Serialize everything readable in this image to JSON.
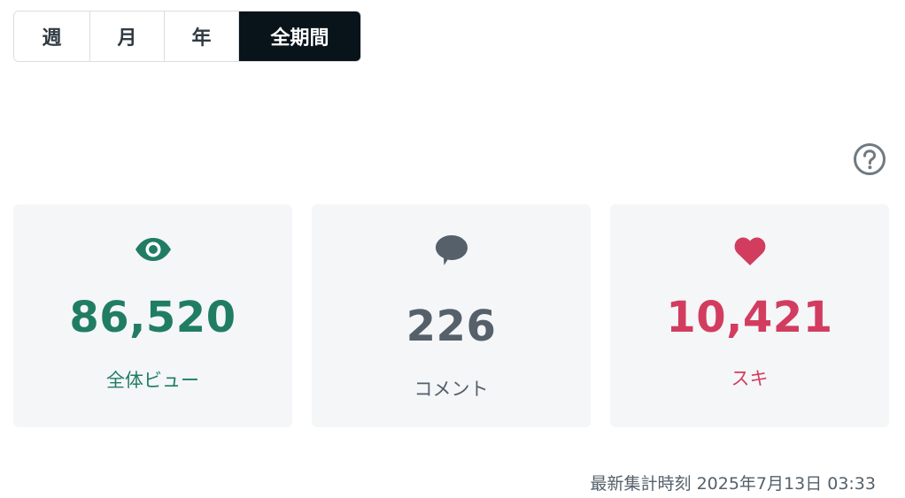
{
  "period_tabs": {
    "items": [
      {
        "label": "週"
      },
      {
        "label": "月"
      },
      {
        "label": "年"
      },
      {
        "label": "全期間"
      }
    ],
    "active": "全期間"
  },
  "help": {
    "icon": "question-circle-icon"
  },
  "stats": {
    "views": {
      "value": "86,520",
      "label": "全体ビュー",
      "icon": "eye-icon",
      "color": "#207d64"
    },
    "comments": {
      "value": "226",
      "label": "コメント",
      "icon": "speech-bubble-icon",
      "color": "#55606a"
    },
    "likes": {
      "value": "10,421",
      "label": "スキ",
      "icon": "heart-icon",
      "color": "#d23d5f"
    }
  },
  "last_updated": {
    "text": "最新集計時刻 2025年7月13日 03:33"
  }
}
